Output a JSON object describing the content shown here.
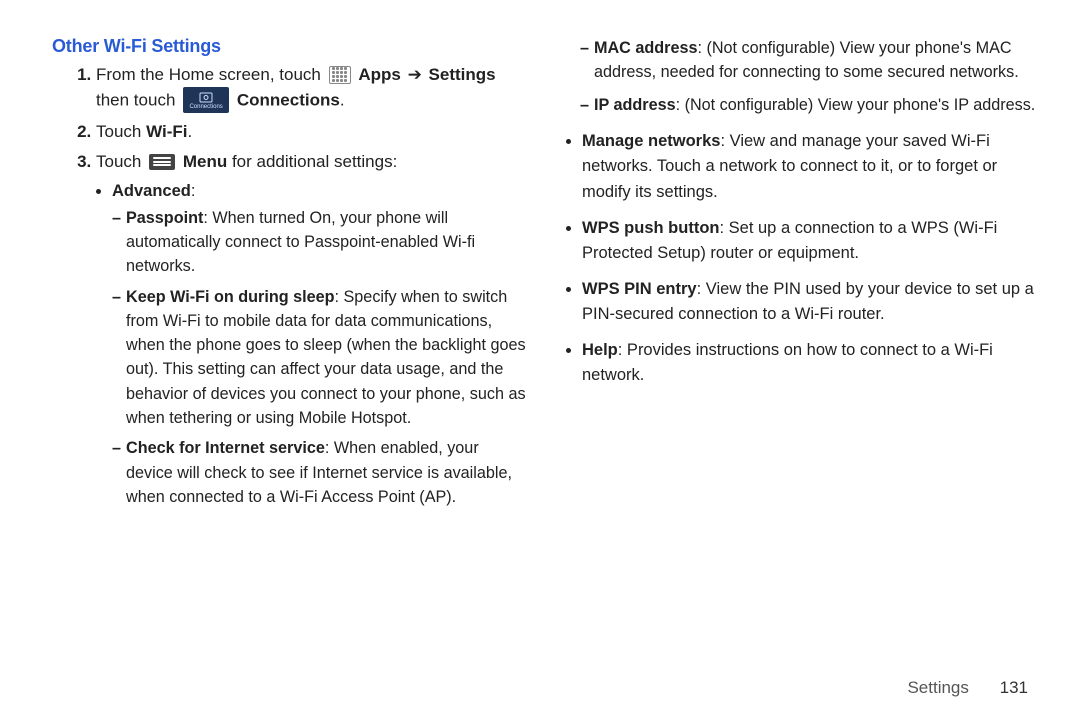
{
  "heading": "Other Wi-Fi Settings",
  "step1": {
    "pre": "From the Home screen, touch ",
    "apps": "Apps",
    "arrow": "➔",
    "settings": "Settings",
    "then": "then touch ",
    "connections": "Connections",
    "dot": "."
  },
  "step2": {
    "pre": "Touch ",
    "wifi": "Wi-Fi",
    "dot": "."
  },
  "step3": {
    "pre": "Touch ",
    "menu": "Menu",
    "post": " for additional settings:",
    "advanced_label": "Advanced",
    "advanced_colon": ":",
    "items": {
      "passpoint_b": "Passpoint",
      "passpoint_t": ": When turned On, your phone will automatically connect to Passpoint-enabled Wi-fi networks.",
      "sleep_b": "Keep Wi-Fi on during sleep",
      "sleep_t": ": Specify when to switch from Wi-Fi to mobile data for data communications, when the phone goes to sleep (when the backlight goes out). This setting can affect your data usage, and the behavior of devices you connect to your phone, such as when tethering or using Mobile Hotspot.",
      "check_b": "Check for Internet service",
      "check_t": ": When enabled, your device will check to see if Internet service is available, when connected to a Wi-Fi Access Point (AP)."
    }
  },
  "right": {
    "mac_b": "MAC address",
    "mac_t": ": (Not configurable) View your phone's MAC address, needed for connecting to some secured networks.",
    "ip_b": "IP address",
    "ip_t": ": (Not configurable) View your phone's IP address.",
    "mn_b": "Manage networks",
    "mn_t": ": View and manage your saved Wi-Fi networks. Touch a network to connect to it, or to forget or modify its settings.",
    "wps_b": "WPS push button",
    "wps_t": ": Set up a connection to a WPS (Wi-Fi Protected Setup) router or equipment.",
    "pin_b": "WPS PIN entry",
    "pin_t": ": View the PIN used by your device to set up a PIN-secured connection to a Wi-Fi router.",
    "help_b": "Help",
    "help_t": ": Provides instructions on how to connect to a Wi-Fi network."
  },
  "footer": {
    "section": "Settings",
    "page": "131"
  },
  "icons": {
    "connections_caption": "Connections"
  }
}
